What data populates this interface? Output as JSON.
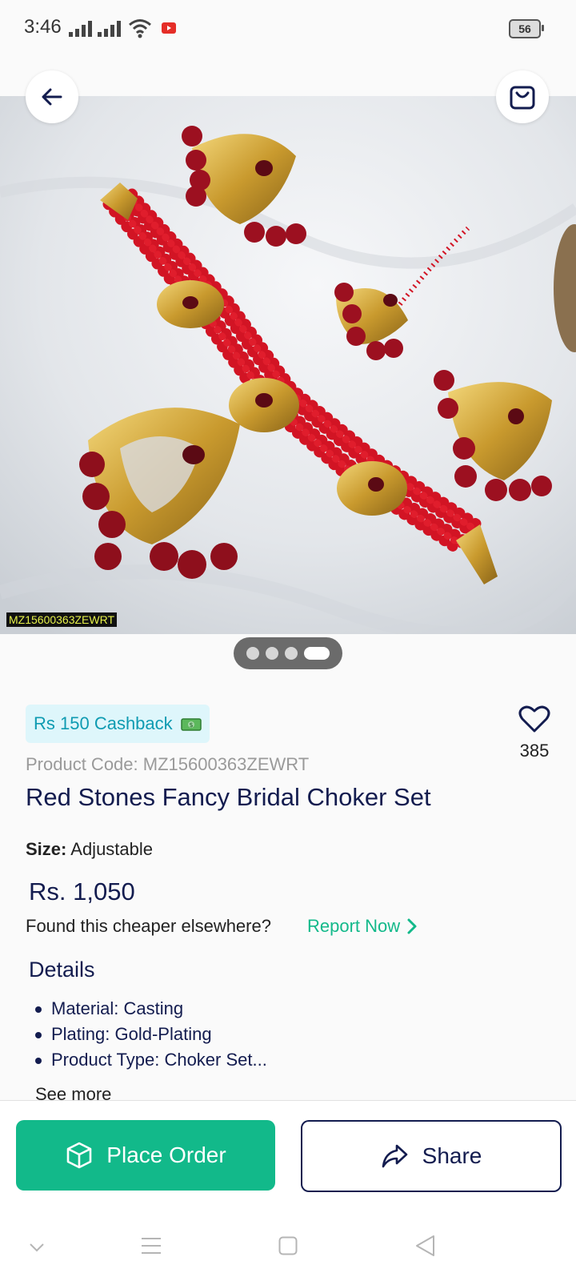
{
  "status_bar": {
    "time": "3:46",
    "battery": "56"
  },
  "gallery": {
    "image_code": "MZ15600363ZEWRT",
    "image_count": 4,
    "active_index": 3
  },
  "product": {
    "cashback": "Rs 150 Cashback",
    "wishlist_count": "385",
    "product_code": "Product Code: MZ15600363ZEWRT",
    "title": "Red Stones Fancy Bridal Choker Set",
    "size_label": "Size:",
    "size_value": "Adjustable",
    "price": "Rs. 1,050",
    "cheaper_prompt": "Found this cheaper elsewhere?",
    "report_label": "Report Now",
    "details_heading": "Details",
    "details": [
      "Material: Casting",
      "Plating: Gold-Plating",
      "Product Type: Choker Set..."
    ],
    "see_more": "See more"
  },
  "actions": {
    "place_order": "Place Order",
    "share": "Share"
  },
  "colors": {
    "accent": "#12b98a",
    "navy": "#131c4f",
    "cashback_bg": "#def6fb",
    "cashback_text": "#0f9bb2"
  },
  "icons": [
    "back-arrow-icon",
    "shopping-bag-icon",
    "heart-icon",
    "money-icon",
    "chevron-right-icon",
    "box-icon",
    "share-arrow-icon",
    "wifi-icon",
    "signal-icon",
    "youtube-icon"
  ]
}
